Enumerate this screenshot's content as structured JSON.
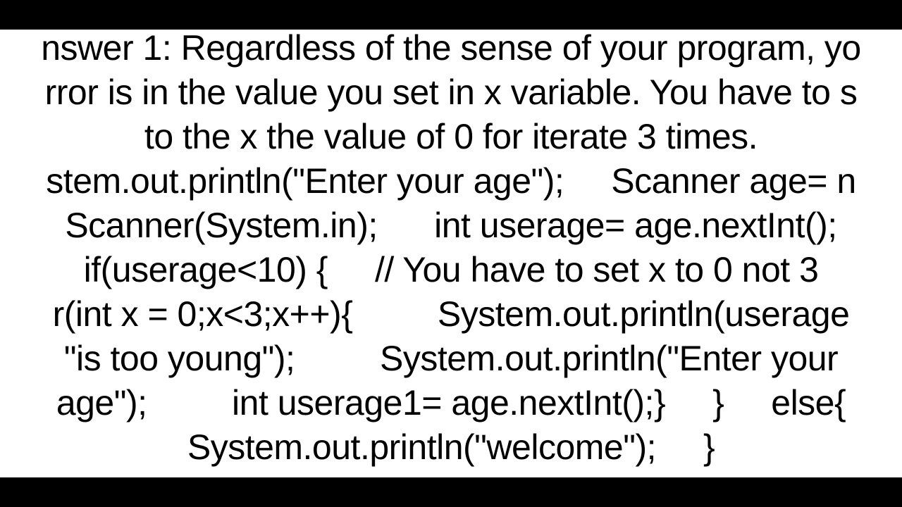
{
  "content": {
    "line1": "nswer 1: Regardless of the sense of your program, yo",
    "line2": "rror is in the value you set in x variable. You have to s",
    "line3": "to the x the value of 0 for iterate 3 times.",
    "line4": "stem.out.println(\"Enter your age\");     Scanner age= n",
    "line5": "Scanner(System.in);      int userage= age.nextInt();",
    "line6": "if(userage<10) {     // You have to set x to 0 not 3",
    "line7": "r(int x = 0;x<3;x++){         System.out.println(userage",
    "line8": "\"is too young\");         System.out.println(\"Enter your",
    "line9": "age\");         int userage1= age.nextInt();}     }     else{",
    "line10": "System.out.println(\"welcome\");     }"
  }
}
